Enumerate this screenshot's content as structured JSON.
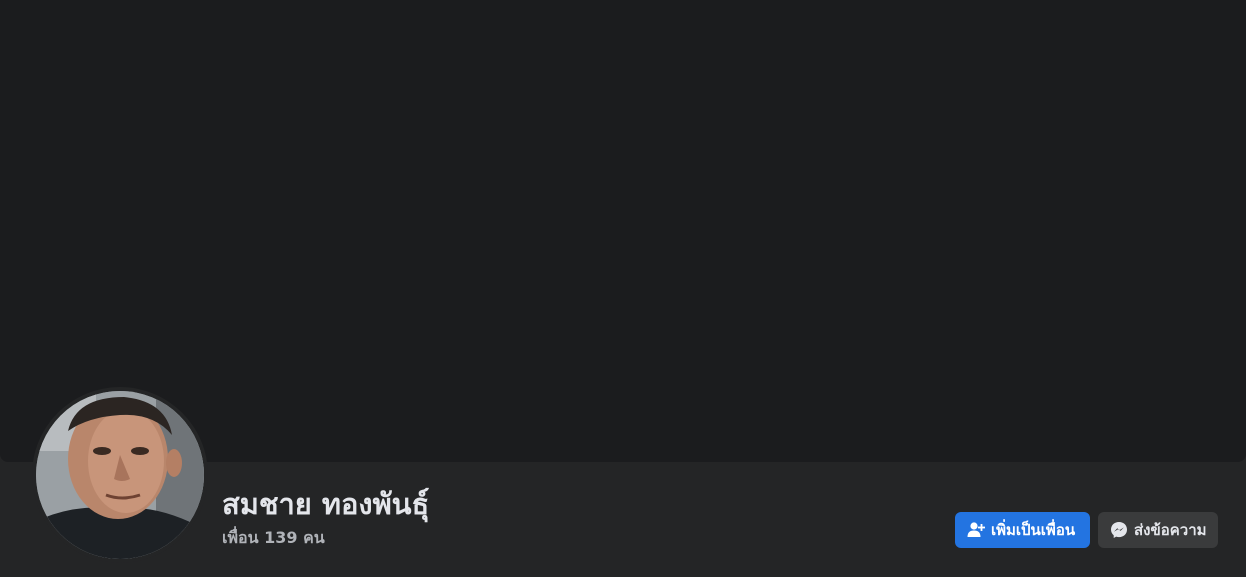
{
  "profile": {
    "name": "สมชาย ทองพันธุ์",
    "friends_count_text": "เพื่อน 139 คน"
  },
  "actions": {
    "add_friend_label": "เพิ่มเป็นเพื่อน",
    "add_friend_icon": "add-friend-icon",
    "message_label": "ส่งข้อความ",
    "message_icon": "messenger-icon"
  },
  "colors": {
    "cover_bg": "#1b1c1e",
    "page_bg": "#242526",
    "primary_button": "#2374e1",
    "secondary_button": "#3a3b3c",
    "name_text": "#e4e6eb",
    "secondary_text": "#b0b3b8"
  }
}
